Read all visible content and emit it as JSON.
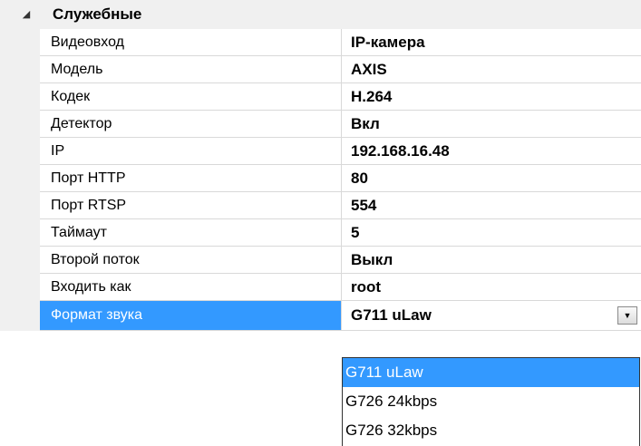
{
  "category": {
    "toggle_icon": "collapse-triangle-icon",
    "label": "Служебные"
  },
  "properties": [
    {
      "name": "Видеовход",
      "value": "IP-камера"
    },
    {
      "name": "Модель",
      "value": "AXIS"
    },
    {
      "name": "Кодек",
      "value": "H.264"
    },
    {
      "name": "Детектор",
      "value": "Вкл"
    },
    {
      "name": "IP",
      "value": "192.168.16.48"
    },
    {
      "name": "Порт HTTP",
      "value": "80"
    },
    {
      "name": "Порт RTSP",
      "value": "554"
    },
    {
      "name": "Таймаут",
      "value": "5"
    },
    {
      "name": "Второй поток",
      "value": "Выкл"
    },
    {
      "name": "Входить как",
      "value": "root"
    },
    {
      "name": "Формат звука",
      "value": "G711 uLaw",
      "selected": true
    }
  ],
  "dropdown": {
    "button_icon": "dropdown-arrow-icon",
    "options": [
      "G711 uLaw",
      "G726 24kbps",
      "G726 32kbps"
    ],
    "selected_index": 0
  },
  "colors": {
    "selection": "#3399ff",
    "gutter": "#f0f0f0",
    "grid_line": "#d9d9d9"
  }
}
